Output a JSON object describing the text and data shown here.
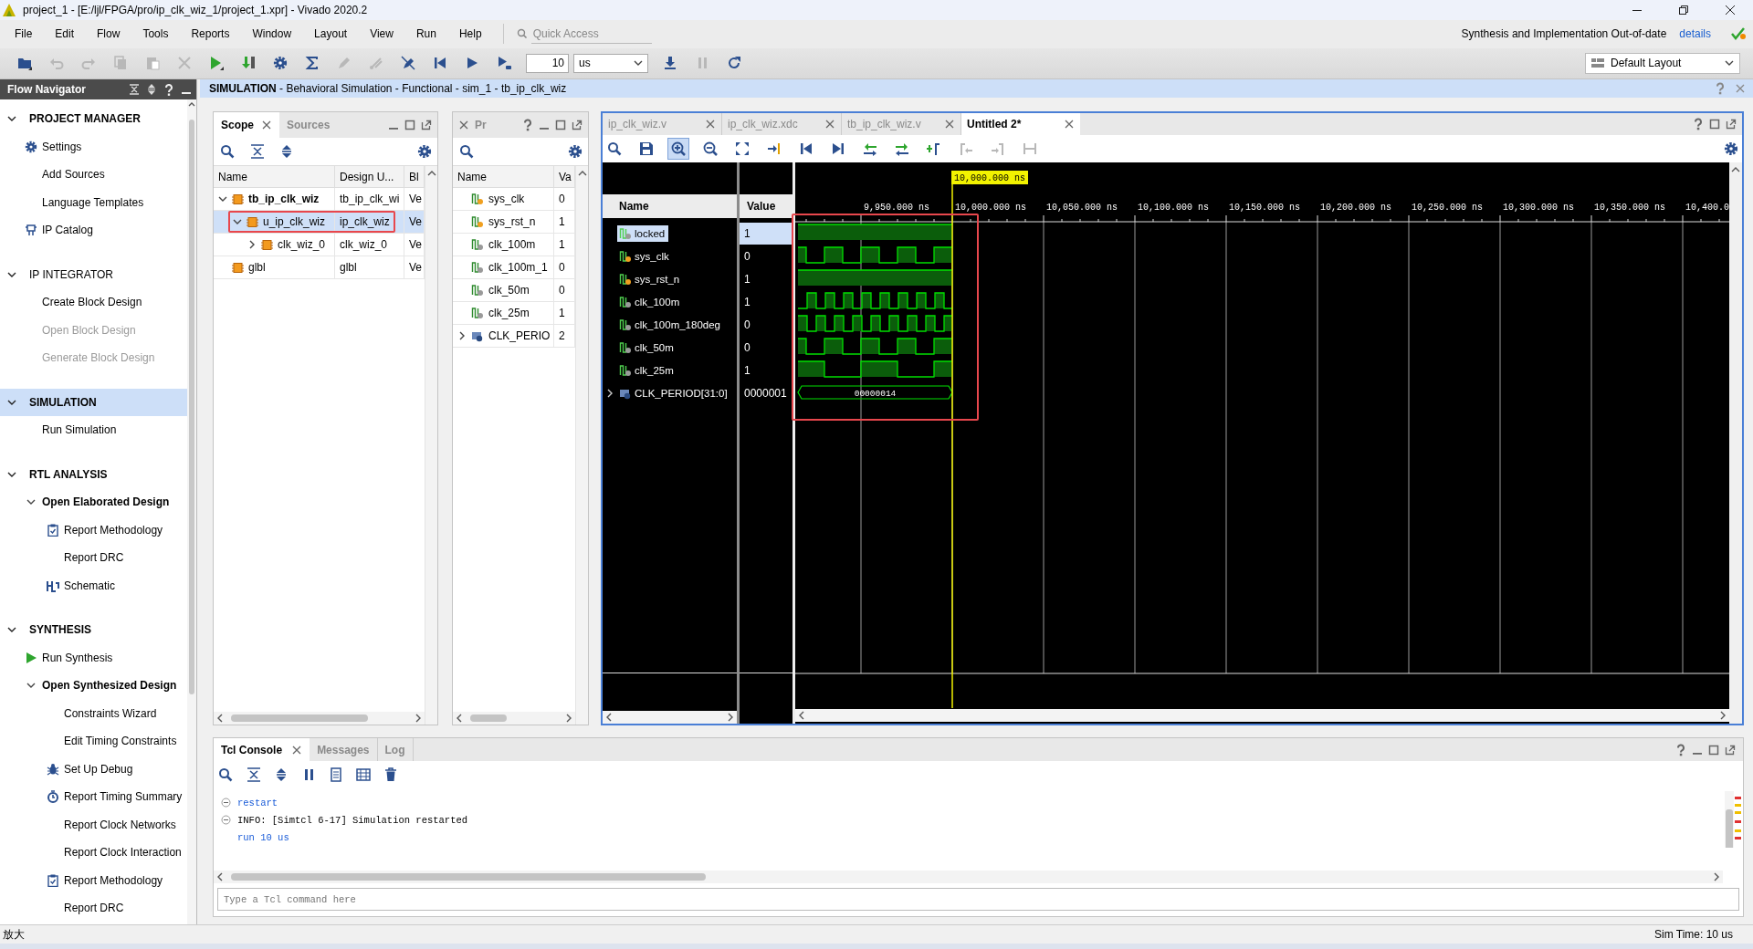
{
  "title_bar": {
    "title": "project_1 - [E:/ljl/FPGA/pro/ip_clk_wiz_1/project_1.xpr] - Vivado 2020.2"
  },
  "menu": [
    {
      "label": "File"
    },
    {
      "label": "Edit"
    },
    {
      "label": "Flow"
    },
    {
      "label": "Tools"
    },
    {
      "label": "Reports"
    },
    {
      "label": "Window"
    },
    {
      "label": "Layout"
    },
    {
      "label": "View"
    },
    {
      "label": "Run"
    },
    {
      "label": "Help"
    }
  ],
  "quick_access": {
    "placeholder": "Quick Access"
  },
  "notice": {
    "text": "Synthesis and Implementation Out-of-date",
    "link": "details"
  },
  "toolbar": {
    "left": [
      {
        "kind": "open",
        "disabled": false
      },
      {
        "kind": "undo",
        "disabled": true
      },
      {
        "kind": "redo",
        "disabled": true
      },
      {
        "kind": "copy",
        "disabled": true
      },
      {
        "kind": "paste",
        "disabled": true
      },
      {
        "kind": "delete",
        "disabled": true
      },
      {
        "kind": "run",
        "disabled": false
      },
      {
        "kind": "program",
        "disabled": false
      },
      {
        "kind": "settings",
        "disabled": false
      },
      {
        "kind": "sigma",
        "disabled": false
      },
      {
        "kind": "pencil",
        "disabled": true
      },
      {
        "kind": "probe",
        "disabled": true
      },
      {
        "kind": "nopen",
        "disabled": false
      },
      {
        "kind": "first",
        "disabled": false
      },
      {
        "kind": "play",
        "disabled": false
      },
      {
        "kind": "playfor",
        "disabled": false
      }
    ],
    "run_time": {
      "value": "10"
    },
    "time_unit": {
      "value": "us"
    },
    "right": [
      {
        "kind": "step",
        "disabled": false
      },
      {
        "kind": "pause",
        "disabled": true
      },
      {
        "kind": "refresh",
        "disabled": false
      }
    ],
    "layout": {
      "value": "Default Layout"
    }
  },
  "flow_navigator": {
    "title": "Flow Navigator",
    "sections": [
      {
        "title": "PROJECT MANAGER",
        "active": true,
        "selected": false,
        "expanded": true,
        "items": [
          {
            "label": "Settings",
            "kind": "settings",
            "disabled": false
          },
          {
            "label": "Add Sources",
            "kind": "plain",
            "disabled": false
          },
          {
            "label": "Language Templates",
            "kind": "plain",
            "disabled": false
          },
          {
            "label": "IP Catalog",
            "kind": "ip-catalog",
            "disabled": false
          }
        ]
      },
      {
        "title": "IP INTEGRATOR",
        "active": false,
        "selected": false,
        "expanded": true,
        "items": [
          {
            "label": "Create Block Design",
            "kind": "plain",
            "disabled": false
          },
          {
            "label": "Open Block Design",
            "kind": "plain",
            "disabled": true
          },
          {
            "label": "Generate Block Design",
            "kind": "plain",
            "disabled": true
          }
        ]
      },
      {
        "title": "SIMULATION",
        "active": true,
        "selected": true,
        "expanded": true,
        "items": [
          {
            "label": "Run Simulation",
            "kind": "plain",
            "disabled": false
          }
        ]
      },
      {
        "title": "RTL ANALYSIS",
        "active": true,
        "selected": false,
        "expanded": true,
        "items": [
          {
            "label": "Open Elaborated Design",
            "disabled": false,
            "expanded": true,
            "children": [
              {
                "label": "Report Methodology",
                "kind": "report",
                "disabled": false
              },
              {
                "label": "Report DRC",
                "kind": "plain",
                "disabled": false
              },
              {
                "label": "Schematic",
                "kind": "schematic",
                "disabled": false
              }
            ]
          }
        ]
      },
      {
        "title": "SYNTHESIS",
        "active": true,
        "selected": false,
        "expanded": true,
        "items": [
          {
            "label": "Run Synthesis",
            "kind": "run",
            "disabled": false
          },
          {
            "label": "Open Synthesized Design",
            "disabled": false,
            "expanded": true,
            "children": [
              {
                "label": "Constraints Wizard",
                "kind": "plain",
                "disabled": false
              },
              {
                "label": "Edit Timing Constraints",
                "kind": "plain",
                "disabled": false
              },
              {
                "label": "Set Up Debug",
                "kind": "debug",
                "disabled": false
              },
              {
                "label": "Report Timing Summary",
                "kind": "timing",
                "disabled": false
              },
              {
                "label": "Report Clock Networks",
                "kind": "plain",
                "disabled": false
              },
              {
                "label": "Report Clock Interaction",
                "kind": "plain",
                "disabled": false
              },
              {
                "label": "Report Methodology",
                "kind": "report",
                "disabled": false
              },
              {
                "label": "Report DRC",
                "kind": "plain",
                "disabled": false
              }
            ]
          }
        ]
      }
    ]
  },
  "view_header": {
    "title": "**SIMULATION** - Behavioral Simulation - Functional - sim_1 - tb_ip_clk_wiz"
  },
  "scope_panel": {
    "tabs": [
      {
        "label": "Scope",
        "selected": true
      },
      {
        "label": "Sources",
        "selected": false
      }
    ],
    "columns": [
      "Name",
      "Design U...",
      "Bl"
    ],
    "tree": [
      {
        "name": "tb_ip_clk_wiz",
        "design_unit": "tb_ip_clk_wi",
        "block": "Ve",
        "top": true,
        "selected": false,
        "highlighted": false,
        "expanded": true,
        "children": [
          {
            "name": "u_ip_clk_wiz",
            "design_unit": "ip_clk_wiz",
            "block": "Ve",
            "top": false,
            "selected": true,
            "highlighted": true,
            "expanded": true,
            "children": [
              {
                "name": "clk_wiz_0",
                "design_unit": "clk_wiz_0",
                "block": "Ve",
                "top": false,
                "selected": false,
                "highlighted": false,
                "expanded": false
              }
            ]
          }
        ]
      },
      {
        "name": "glbl",
        "design_unit": "glbl",
        "block": "Ve",
        "top": false,
        "selected": false,
        "highlighted": false
      }
    ]
  },
  "objects_panel": {
    "tab": "Pr",
    "columns": [
      "Name",
      "Va"
    ],
    "rows": [
      {
        "name": "sys_clk",
        "value": "0",
        "kind": "input"
      },
      {
        "name": "sys_rst_n",
        "value": "1",
        "kind": "input"
      },
      {
        "name": "clk_100m",
        "value": "1",
        "kind": "output"
      },
      {
        "name": "clk_100m_1",
        "value": "0",
        "kind": "output"
      },
      {
        "name": "clk_50m",
        "value": "0",
        "kind": "output"
      },
      {
        "name": "clk_25m",
        "value": "1",
        "kind": "output"
      },
      {
        "name": "CLK_PERIO",
        "value": "2",
        "kind": "constant",
        "expanded": false
      }
    ]
  },
  "wave_window": {
    "tabs": [
      {
        "label": "ip_clk_wiz.v",
        "selected": false
      },
      {
        "label": "ip_clk_wiz.xdc",
        "selected": false
      },
      {
        "label": "tb_ip_clk_wiz.v",
        "selected": false
      },
      {
        "label": "Untitled 2*",
        "selected": true
      }
    ],
    "toolbar": [
      {
        "kind": "search",
        "disabled": false,
        "selected": false
      },
      {
        "kind": "save",
        "disabled": false,
        "selected": false
      },
      {
        "kind": "zoomin",
        "disabled": false,
        "selected": true
      },
      {
        "kind": "zoomout",
        "disabled": false,
        "selected": false
      },
      {
        "kind": "fit",
        "disabled": false,
        "selected": false
      },
      {
        "kind": "tocursor",
        "disabled": false,
        "selected": false
      },
      {
        "kind": "first",
        "disabled": false,
        "selected": false
      },
      {
        "kind": "last",
        "disabled": false,
        "selected": false
      },
      {
        "kind": "swapl",
        "disabled": false,
        "selected": false
      },
      {
        "kind": "swapr",
        "disabled": false,
        "selected": false
      },
      {
        "kind": "addmarker",
        "disabled": false,
        "selected": false
      },
      {
        "kind": "markl",
        "disabled": true,
        "selected": false
      },
      {
        "kind": "markr",
        "disabled": true,
        "selected": false
      },
      {
        "kind": "markspan",
        "disabled": true,
        "selected": false
      }
    ],
    "columns": [
      "Name",
      "Value"
    ],
    "cursor_label": "10,000.000 ns",
    "time_ticks": [
      "9,950.000 ns",
      "10,000.000 ns",
      "10,050.000 ns",
      "10,100.000 ns",
      "10,150.000 ns",
      "10,200.000 ns",
      "10,250.000 ns",
      "10,300.000 ns",
      "10,350.000 ns",
      "10,400.0"
    ],
    "signals": [
      {
        "name": "locked",
        "value": "1",
        "kind": "output",
        "waveform": {
          "kind": "high"
        },
        "selected": true
      },
      {
        "name": "sys_clk",
        "value": "0",
        "kind": "input",
        "waveform": {
          "kind": "clk20ns"
        },
        "selected": false
      },
      {
        "name": "sys_rst_n",
        "value": "1",
        "kind": "input",
        "waveform": {
          "kind": "high"
        },
        "selected": false
      },
      {
        "name": "clk_100m",
        "value": "1",
        "kind": "output",
        "waveform": {
          "kind": "clk10ns"
        },
        "selected": false
      },
      {
        "name": "clk_100m_180deg",
        "value": "0",
        "kind": "output",
        "waveform": {
          "kind": "clk10nsinv"
        },
        "selected": false
      },
      {
        "name": "clk_50m",
        "value": "0",
        "kind": "output",
        "waveform": {
          "kind": "clk20ns"
        },
        "selected": false
      },
      {
        "name": "clk_25m",
        "value": "1",
        "kind": "output",
        "waveform": {
          "kind": "clk40ns"
        },
        "selected": false
      },
      {
        "name": "CLK_PERIOD[31:0]",
        "value": "0000001",
        "kind": "constant",
        "waveform": {
          "kind": "bus",
          "value": "00000014"
        },
        "selected": false,
        "expanded": false
      }
    ],
    "highlight_box": true
  },
  "tcl_console": {
    "tabs": [
      {
        "label": "Tcl Console",
        "selected": true
      },
      {
        "label": "Messages",
        "selected": false
      },
      {
        "label": "Log",
        "selected": false
      }
    ],
    "lines": [
      {
        "text": "restart",
        "kind": "command",
        "foldable": true
      },
      {
        "text": "INFO: [Simtcl 6-17] Simulation restarted",
        "kind": "info",
        "foldable": true
      },
      {
        "text": "run 10 us",
        "kind": "command",
        "foldable": false
      }
    ],
    "input": {
      "placeholder": "Type a Tcl command here"
    }
  },
  "status_bar": {
    "left": "放大",
    "right": "Sim Time: 10 us"
  }
}
